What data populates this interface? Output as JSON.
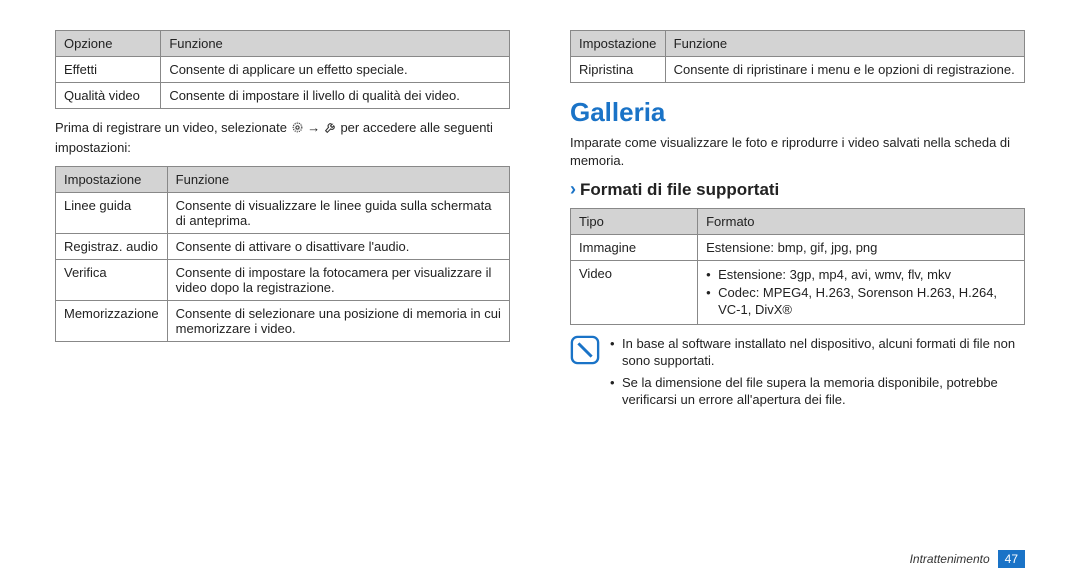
{
  "left": {
    "table1": {
      "headers": [
        "Opzione",
        "Funzione"
      ],
      "rows": [
        [
          "Effetti",
          "Consente di applicare un effetto speciale."
        ],
        [
          "Qualità video",
          "Consente di impostare il livello di qualità dei video."
        ]
      ]
    },
    "para_before": "Prima di registrare un video, selezionate ",
    "para_after": " per accedere alle seguenti impostazioni:",
    "table2": {
      "headers": [
        "Impostazione",
        "Funzione"
      ],
      "rows": [
        [
          "Linee guida",
          "Consente di visualizzare le linee guida sulla schermata di anteprima."
        ],
        [
          "Registraz. audio",
          "Consente di attivare o disattivare l'audio."
        ],
        [
          "Verifica",
          "Consente di impostare la fotocamera per visualizzare il video dopo la registrazione."
        ],
        [
          "Memorizzazione",
          "Consente di selezionare una posizione di memoria in cui memorizzare i video."
        ]
      ]
    }
  },
  "right": {
    "table1": {
      "headers": [
        "Impostazione",
        "Funzione"
      ],
      "rows": [
        [
          "Ripristina",
          "Consente di ripristinare i menu e le opzioni di registrazione."
        ]
      ]
    },
    "section_title": "Galleria",
    "intro": "Imparate come visualizzare le foto e riprodurre i video salvati nella scheda di memoria.",
    "subhead": "Formati di file supportati",
    "table2": {
      "headers": [
        "Tipo",
        "Formato"
      ],
      "rows": [
        {
          "c0": "Immagine",
          "c1": "Estensione: bmp, gif, jpg, png"
        },
        {
          "c0": "Video",
          "c1_list": [
            "Estensione: 3gp, mp4, avi, wmv, flv, mkv",
            "Codec: MPEG4, H.263, Sorenson H.263, H.264, VC-1, DivX®"
          ]
        }
      ]
    },
    "notes": [
      "In base al software installato nel dispositivo, alcuni formati di file non sono supportati.",
      "Se la dimensione del file supera la memoria disponibile, potrebbe verificarsi un errore all'apertura dei file."
    ]
  },
  "footer": {
    "section": "Intrattenimento",
    "page": "47"
  }
}
